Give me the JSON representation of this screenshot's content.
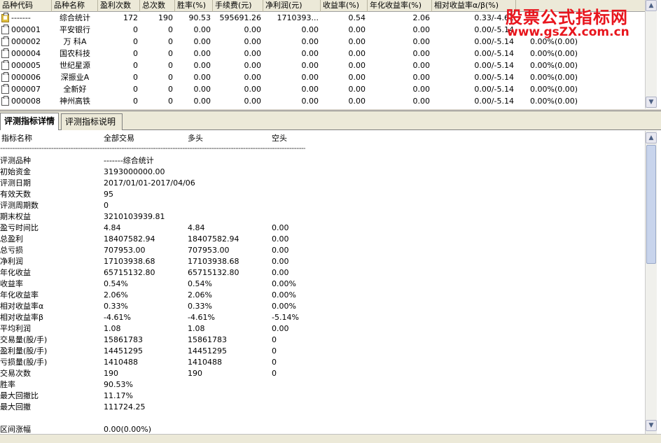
{
  "grid": {
    "columns": [
      "品种代码",
      "品种名称",
      "盈利次数",
      "总次数",
      "胜率(%)",
      "手续费(元)",
      "净利润(元)",
      "收益率(%)",
      "年化收益率(%)",
      "相对收益率α/β(%)"
    ],
    "rows": [
      {
        "code": "-------",
        "name": "综合统计",
        "wins": "172",
        "total": "190",
        "winrate": "90.53",
        "fee": "595691.26",
        "profit": "1710393...",
        "ret": "0.54",
        "annual": "2.06",
        "relative": "0.33/-4.61",
        "extra": "",
        "icon": "summary"
      },
      {
        "code": "000001",
        "name": "平安银行",
        "wins": "0",
        "total": "0",
        "winrate": "0.00",
        "fee": "0.00",
        "profit": "0.00",
        "ret": "0.00",
        "annual": "0.00",
        "relative": "0.00/-5.14",
        "extra": "",
        "icon": "doc"
      },
      {
        "code": "000002",
        "name": "万 科A",
        "wins": "0",
        "total": "0",
        "winrate": "0.00",
        "fee": "0.00",
        "profit": "0.00",
        "ret": "0.00",
        "annual": "0.00",
        "relative": "0.00/-5.14",
        "extra": "0.00%(0.00)",
        "icon": "doc"
      },
      {
        "code": "000004",
        "name": "国农科技",
        "wins": "0",
        "total": "0",
        "winrate": "0.00",
        "fee": "0.00",
        "profit": "0.00",
        "ret": "0.00",
        "annual": "0.00",
        "relative": "0.00/-5.14",
        "extra": "0.00%(0.00)",
        "icon": "doc"
      },
      {
        "code": "000005",
        "name": "世纪星源",
        "wins": "0",
        "total": "0",
        "winrate": "0.00",
        "fee": "0.00",
        "profit": "0.00",
        "ret": "0.00",
        "annual": "0.00",
        "relative": "0.00/-5.14",
        "extra": "0.00%(0.00)",
        "icon": "doc"
      },
      {
        "code": "000006",
        "name": "深振业A",
        "wins": "0",
        "total": "0",
        "winrate": "0.00",
        "fee": "0.00",
        "profit": "0.00",
        "ret": "0.00",
        "annual": "0.00",
        "relative": "0.00/-5.14",
        "extra": "0.00%(0.00)",
        "icon": "doc"
      },
      {
        "code": "000007",
        "name": "全新好",
        "wins": "0",
        "total": "0",
        "winrate": "0.00",
        "fee": "0.00",
        "profit": "0.00",
        "ret": "0.00",
        "annual": "0.00",
        "relative": "0.00/-5.14",
        "extra": "0.00%(0.00)",
        "icon": "doc"
      },
      {
        "code": "000008",
        "name": "神州高铁",
        "wins": "0",
        "total": "0",
        "winrate": "0.00",
        "fee": "0.00",
        "profit": "0.00",
        "ret": "0.00",
        "annual": "0.00",
        "relative": "0.00/-5.14",
        "extra": "0.00%(0.00)",
        "icon": "doc"
      }
    ]
  },
  "watermark": {
    "title": "股票公式指标网",
    "url": "www.gsZX.com.cn",
    "color": "#e8151d"
  },
  "tabs": [
    {
      "label": "评测指标详情",
      "active": true
    },
    {
      "label": "评测指标说明",
      "active": false
    }
  ],
  "detail": {
    "headers": [
      "指标名称",
      "全部交易",
      "多头",
      "空头"
    ],
    "separator": "--------------------------------------------------------------------------------------------------------------------------------------",
    "rows": [
      {
        "name": "评测品种",
        "all": "-------综合统计",
        "long": "",
        "short": ""
      },
      {
        "name": "初始资金",
        "all": "3193000000.00",
        "long": "",
        "short": ""
      },
      {
        "name": "评测日期",
        "all": "2017/01/01-2017/04/06",
        "long": "",
        "short": ""
      },
      {
        "name": "有效天数",
        "all": "95",
        "long": "",
        "short": ""
      },
      {
        "name": "评测周期数",
        "all": "0",
        "long": "",
        "short": ""
      },
      {
        "name": "期末权益",
        "all": "3210103939.81",
        "long": "",
        "short": ""
      },
      {
        "name": "盈亏时间比",
        "all": "4.84",
        "long": "4.84",
        "short": "0.00"
      },
      {
        "name": "总盈利",
        "all": "18407582.94",
        "long": "18407582.94",
        "short": "0.00"
      },
      {
        "name": "总亏损",
        "all": "707953.00",
        "long": "707953.00",
        "short": "0.00"
      },
      {
        "name": "净利润",
        "all": "17103938.68",
        "long": "17103938.68",
        "short": "0.00"
      },
      {
        "name": "年化收益",
        "all": "65715132.80",
        "long": "65715132.80",
        "short": "0.00"
      },
      {
        "name": "收益率",
        "all": "0.54%",
        "long": "0.54%",
        "short": "0.00%"
      },
      {
        "name": "年化收益率",
        "all": "2.06%",
        "long": "2.06%",
        "short": "0.00%"
      },
      {
        "name": "相对收益率α",
        "all": "0.33%",
        "long": " 0.33%",
        "short": " 0.00%"
      },
      {
        "name": "相对收益率β",
        "all": "-4.61%",
        "long": " -4.61%",
        "short": " -5.14%"
      },
      {
        "name": "平均利润",
        "all": "1.08",
        "long": "1.08",
        "short": "0.00"
      },
      {
        "name": "交易量(股/手)",
        "all": "15861783",
        "long": "15861783",
        "short": "0"
      },
      {
        "name": "盈利量(股/手)",
        "all": "14451295",
        "long": "14451295",
        "short": "0"
      },
      {
        "name": "亏损量(股/手)",
        "all": "1410488",
        "long": "1410488",
        "short": "0"
      },
      {
        "name": "交易次数",
        "all": "190",
        "long": "190",
        "short": "0"
      },
      {
        "name": "胜率",
        "all": "90.53%",
        "long": "",
        "short": ""
      },
      {
        "name": "最大回撤比",
        "all": "11.17%",
        "long": "",
        "short": ""
      },
      {
        "name": "最大回撤",
        "all": "111724.25",
        "long": "",
        "short": ""
      },
      {
        "name": "",
        "all": "",
        "long": "",
        "short": ""
      },
      {
        "name": "区间涨幅",
        "all": "0.00(0.00%)",
        "long": "",
        "short": ""
      }
    ]
  }
}
